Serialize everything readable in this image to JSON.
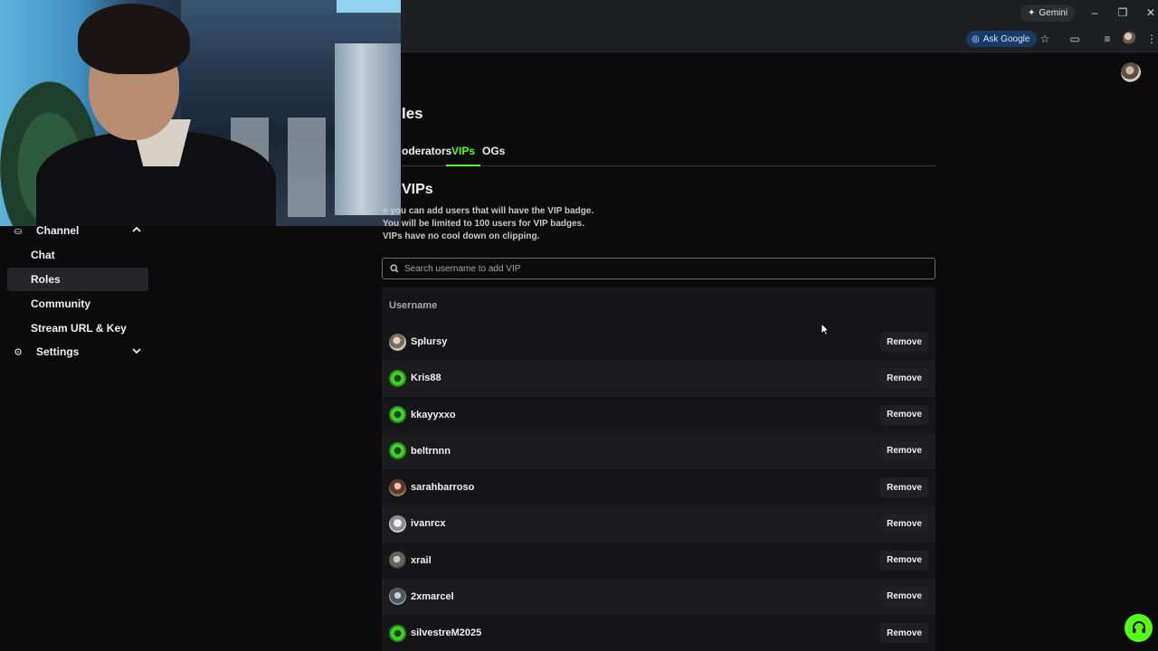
{
  "browser": {
    "gemini_label": "Gemini",
    "ask_google_label": "Ask Google"
  },
  "sidebar": {
    "channel_label": "Channel",
    "items": [
      {
        "label": "Chat"
      },
      {
        "label": "Roles"
      },
      {
        "label": "Community"
      },
      {
        "label": "Stream URL & Key"
      }
    ],
    "settings_label": "Settings"
  },
  "main": {
    "title_visible": "les",
    "tabs": [
      {
        "label": "oderators"
      },
      {
        "label": "VIPs"
      },
      {
        "label": "OGs"
      }
    ],
    "section_title": "VIPs",
    "desc_lines": [
      "e you can add users that will have the VIP badge.",
      "You will be limited to 100 users for VIP badges.",
      "VIPs have no cool down on clipping."
    ],
    "search_placeholder": "Search username to add VIP",
    "column_header": "Username",
    "remove_label": "Remove",
    "users": [
      {
        "name": "Splursy"
      },
      {
        "name": "Kris88"
      },
      {
        "name": "kkayyxxo"
      },
      {
        "name": "beltrnnn"
      },
      {
        "name": "sarahbarroso"
      },
      {
        "name": "ivanrcx"
      },
      {
        "name": "xrail"
      },
      {
        "name": "2xmarcel"
      },
      {
        "name": "silvestreM2025"
      }
    ]
  },
  "colors": {
    "accent": "#53fc18",
    "background": "#0b0b0c",
    "table_bg": "#161618"
  }
}
